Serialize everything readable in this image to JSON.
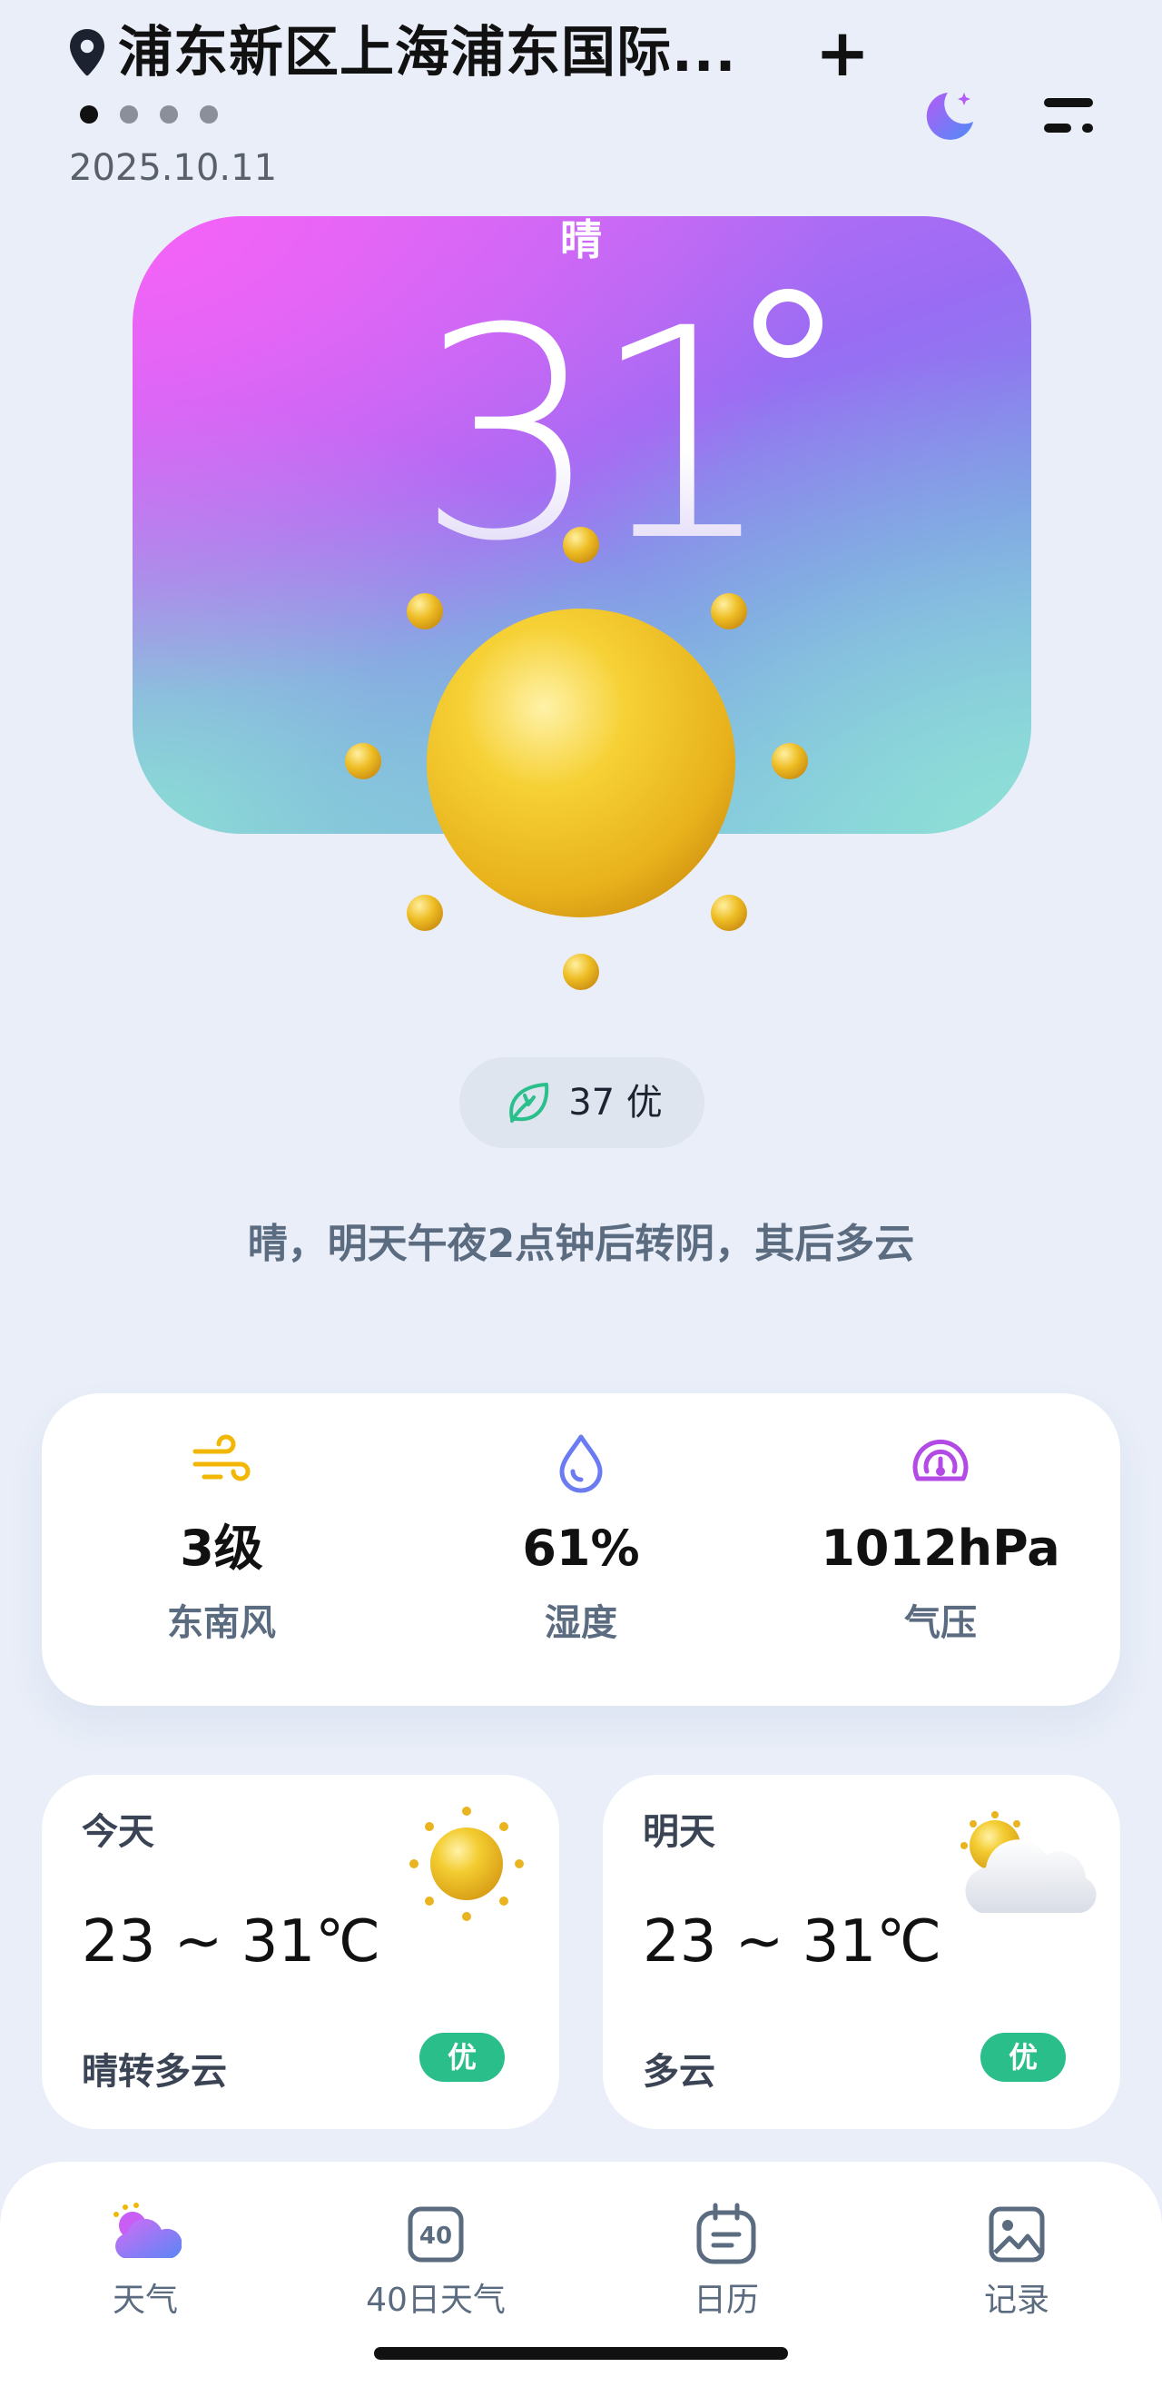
{
  "header": {
    "location": "浦东新区上海浦东国际...",
    "add_label": "+",
    "date": "2025.10.11",
    "page_dots": {
      "total": 4,
      "active_index": 0
    },
    "icons": {
      "location": "location-pin-icon",
      "theme": "moon-icon",
      "menu": "menu-icon"
    }
  },
  "current": {
    "condition": "晴",
    "temperature": "31",
    "weather_icon": "sun-icon"
  },
  "air_quality": {
    "text": "37 优",
    "icon": "leaf-icon"
  },
  "summary": "晴，明天午夜2点钟后转阴，其后多云",
  "stats": [
    {
      "value": "3级",
      "label": "东南风",
      "icon": "wind-icon",
      "color": "#f2b705"
    },
    {
      "value": "61%",
      "label": "湿度",
      "icon": "humidity-drop-icon",
      "color": "#6b7cf2"
    },
    {
      "value": "1012hPa",
      "label": "气压",
      "icon": "pressure-gauge-icon",
      "color": "#b44ae6"
    }
  ],
  "forecast": [
    {
      "day": "今天",
      "range": "23 ~ 31℃",
      "condition": "晴转多云",
      "aqi_badge": "优",
      "icon": "sun-icon"
    },
    {
      "day": "明天",
      "range": "23 ~ 31℃",
      "condition": "多云",
      "aqi_badge": "优",
      "icon": "partly-cloudy-icon"
    }
  ],
  "nav": {
    "items": [
      {
        "label": "天气",
        "icon": "weather-icon",
        "active": true
      },
      {
        "label": "40日天气",
        "icon": "forty-day-icon",
        "active": false
      },
      {
        "label": "日历",
        "icon": "calendar-icon",
        "active": false
      },
      {
        "label": "记录",
        "icon": "gallery-icon",
        "active": false
      }
    ]
  },
  "colors": {
    "background": "#e9eef8",
    "badge_green": "#29be8a",
    "text_secondary": "#5b6b80"
  }
}
